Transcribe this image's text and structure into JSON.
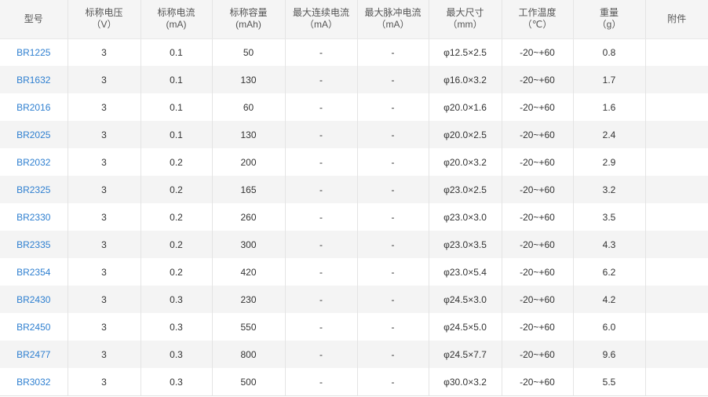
{
  "table": {
    "headers": [
      {
        "l1": "型号",
        "l2": ""
      },
      {
        "l1": "标称电压",
        "l2": "（V）"
      },
      {
        "l1": "标称电流",
        "l2": "(mA)"
      },
      {
        "l1": "标称容量",
        "l2": "(mAh)"
      },
      {
        "l1": "最大连续电流",
        "l2": "（mA）"
      },
      {
        "l1": "最大脉冲电流",
        "l2": "（mA）"
      },
      {
        "l1": "最大尺寸",
        "l2": "（mm）"
      },
      {
        "l1": "工作温度",
        "l2": "（℃）"
      },
      {
        "l1": "重量",
        "l2": "（g）"
      },
      {
        "l1": "附件",
        "l2": ""
      }
    ],
    "rows": [
      [
        "BR1225",
        "3",
        "0.1",
        "50",
        "-",
        "-",
        "φ12.5×2.5",
        "-20~+60",
        "0.8",
        ""
      ],
      [
        "BR1632",
        "3",
        "0.1",
        "130",
        "-",
        "-",
        "φ16.0×3.2",
        "-20~+60",
        "1.7",
        ""
      ],
      [
        "BR2016",
        "3",
        "0.1",
        "60",
        "-",
        "-",
        "φ20.0×1.6",
        "-20~+60",
        "1.6",
        ""
      ],
      [
        "BR2025",
        "3",
        "0.1",
        "130",
        "-",
        "-",
        "φ20.0×2.5",
        "-20~+60",
        "2.4",
        ""
      ],
      [
        "BR2032",
        "3",
        "0.2",
        "200",
        "-",
        "-",
        "φ20.0×3.2",
        "-20~+60",
        "2.9",
        ""
      ],
      [
        "BR2325",
        "3",
        "0.2",
        "165",
        "-",
        "-",
        "φ23.0×2.5",
        "-20~+60",
        "3.2",
        ""
      ],
      [
        "BR2330",
        "3",
        "0.2",
        "260",
        "-",
        "-",
        "φ23.0×3.0",
        "-20~+60",
        "3.5",
        ""
      ],
      [
        "BR2335",
        "3",
        "0.2",
        "300",
        "-",
        "-",
        "φ23.0×3.5",
        "-20~+60",
        "4.3",
        ""
      ],
      [
        "BR2354",
        "3",
        "0.2",
        "420",
        "-",
        "-",
        "φ23.0×5.4",
        "-20~+60",
        "6.2",
        ""
      ],
      [
        "BR2430",
        "3",
        "0.3",
        "230",
        "-",
        "-",
        "φ24.5×3.0",
        "-20~+60",
        "4.2",
        ""
      ],
      [
        "BR2450",
        "3",
        "0.3",
        "550",
        "-",
        "-",
        "φ24.5×5.0",
        "-20~+60",
        "6.0",
        ""
      ],
      [
        "BR2477",
        "3",
        "0.3",
        "800",
        "-",
        "-",
        "φ24.5×7.7",
        "-20~+60",
        "9.6",
        ""
      ],
      [
        "BR3032",
        "3",
        "0.3",
        "500",
        "-",
        "-",
        "φ30.0×3.2",
        "-20~+60",
        "5.5",
        ""
      ]
    ]
  },
  "colors": {
    "header_bg": "#f5f5f5",
    "row_alt_bg": "#f4f4f4",
    "link": "#2e7fd0",
    "text": "#333333"
  }
}
